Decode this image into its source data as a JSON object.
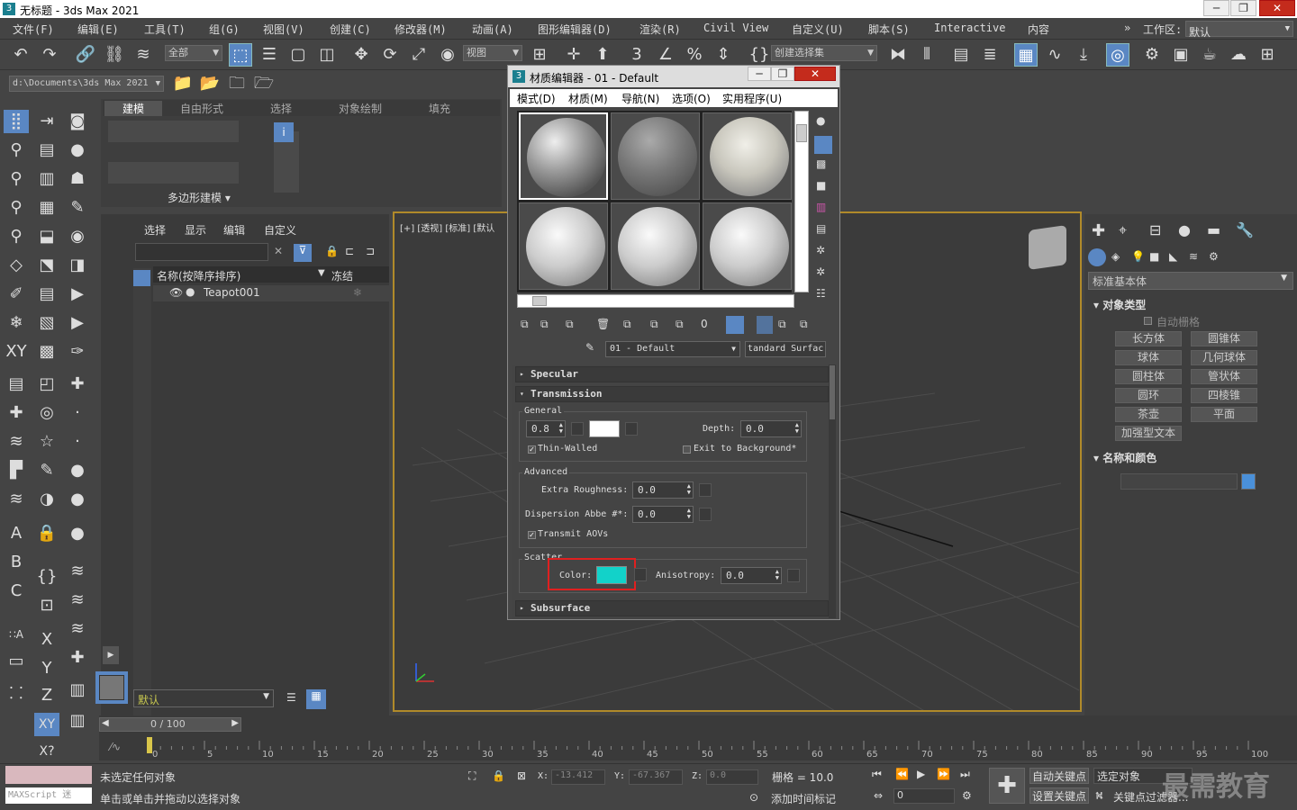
{
  "app": {
    "title": "无标题 - 3ds Max 2021",
    "icon": "3"
  },
  "menu": [
    "文件(F)",
    "编辑(E)",
    "工具(T)",
    "组(G)",
    "视图(V)",
    "创建(C)",
    "修改器(M)",
    "动画(A)",
    "图形编辑器(D)",
    "渲染(R)",
    "Civil View",
    "自定义(U)",
    "脚本(S)",
    "Interactive",
    "内容"
  ],
  "workspace": {
    "label": "工作区:",
    "value": "默认"
  },
  "toolbar": {
    "selection_filter": "全部",
    "ref_coord": "视图",
    "named_sel": "创建选择集"
  },
  "path": "d:\\Documents\\3ds Max 2021",
  "ribbon": {
    "tabs": [
      "建模",
      "自由形式",
      "选择",
      "对象绘制",
      "填充"
    ],
    "panel_label": "多边形建模"
  },
  "scene_explorer": {
    "tabs": [
      "选择",
      "显示",
      "编辑",
      "自定义"
    ],
    "col_name": "名称(按降序排序)",
    "col_freeze": "冻结",
    "items": [
      "Teapot001"
    ],
    "layer": "默认"
  },
  "viewport": {
    "label": "[+] [透视] [标准] [默认"
  },
  "material_editor": {
    "title": "材质编辑器 - 01 - Default",
    "menu": [
      "模式(D)",
      "材质(M)",
      "导航(N)",
      "选项(O)",
      "实用程序(U)"
    ],
    "material_name": "01 - Default",
    "material_type": "tandard Surfac",
    "rollouts": {
      "specular": "Specular",
      "transmission": "Transmission",
      "subsurface": "Subsurface"
    },
    "general": {
      "header": "General",
      "weight": "0.8",
      "depth_label": "Depth:",
      "depth": "0.0",
      "thin_walled": "Thin-Walled",
      "exit_bg": "Exit to Background*"
    },
    "advanced": {
      "header": "Advanced",
      "extra_rough_label": "Extra Roughness:",
      "extra_rough": "0.0",
      "abbe_label": "Dispersion Abbe #*:",
      "abbe": "0.0",
      "transmit_aovs": "Transmit AOVs"
    },
    "scatter": {
      "header": "Scatter",
      "color_label": "Color:",
      "color": "#12d2c9",
      "anisotropy_label": "Anisotropy:",
      "anisotropy": "0.0"
    }
  },
  "command_panel": {
    "category": "标准基本体",
    "object_type": "对象类型",
    "autogrid": "自动栅格",
    "buttons": [
      "长方体",
      "圆锥体",
      "球体",
      "几何球体",
      "圆柱体",
      "管状体",
      "圆环",
      "四棱锥",
      "茶壶",
      "平面",
      "加强型文本"
    ],
    "name_color": "名称和颜色",
    "object_color": "#4a90d9"
  },
  "timeline": {
    "frame": "0 / 100",
    "ticks": [
      "0",
      "5",
      "10",
      "15",
      "20",
      "25",
      "30",
      "35",
      "40",
      "45",
      "50",
      "55",
      "60",
      "65",
      "70",
      "75",
      "80",
      "85",
      "90",
      "95",
      "100"
    ]
  },
  "status": {
    "maxscript": "MAXScript 迷",
    "line1": "未选定任何对象",
    "line2": "单击或单击并拖动以选择对象",
    "x_label": "X:",
    "x": "-13.412",
    "y_label": "Y:",
    "y": "-67.367",
    "z_label": "Z:",
    "z": "0.0",
    "grid": "栅格 = 10.0",
    "add_time_tag": "添加时间标记",
    "auto_key": "自动关键点",
    "set_key": "设置关键点",
    "selected_obj": "选定对象",
    "key_filter": "关键点过滤器...",
    "current_frame": "0",
    "watermark": "最需教育"
  }
}
